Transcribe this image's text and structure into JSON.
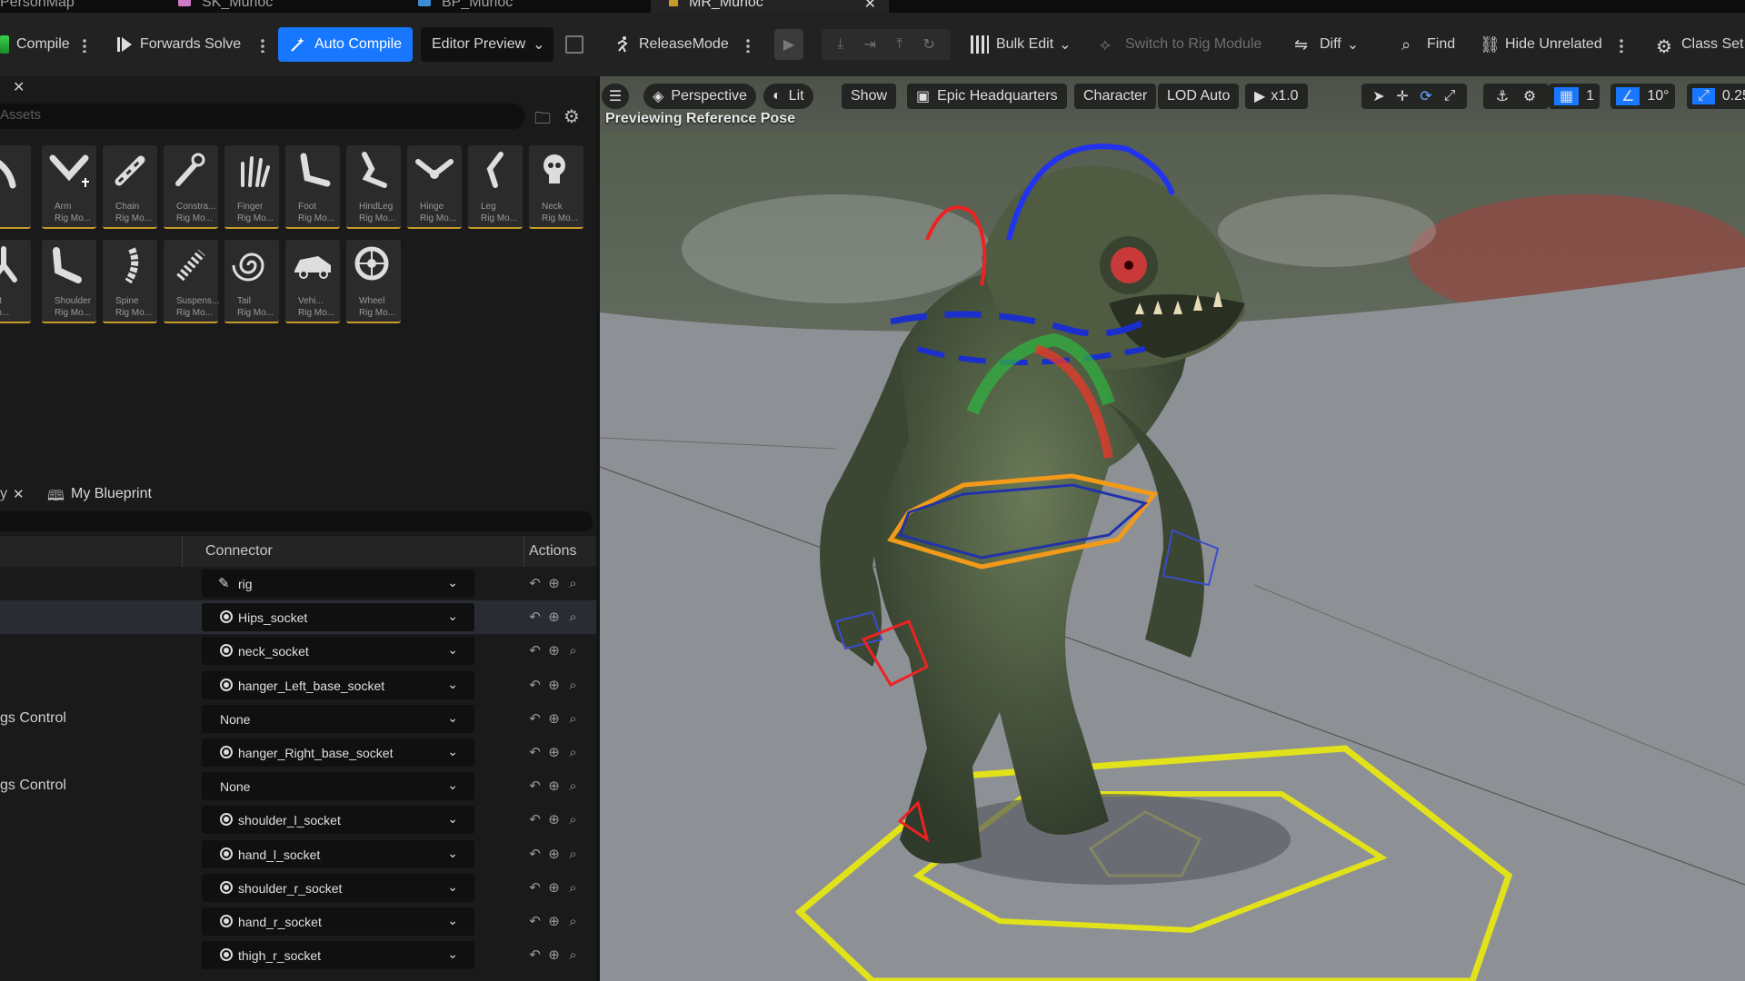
{
  "tabs": [
    {
      "label": "PersonMap",
      "active": false
    },
    {
      "label": "SK_Murloc",
      "active": false
    },
    {
      "label": "BP_Murloc",
      "active": false
    },
    {
      "label": "MR_Murloc",
      "active": true
    }
  ],
  "toolbar": {
    "compile": "Compile",
    "forwards_solve": "Forwards Solve",
    "auto_compile": "Auto Compile",
    "editor_preview": "Editor Preview",
    "release_mode": "ReleaseMode",
    "bulk_edit": "Bulk Edit",
    "switch_rig": "Switch to Rig Module",
    "diff": "Diff",
    "find": "Find",
    "hide_unrelated": "Hide Unrelated",
    "class_settings": "Class Set"
  },
  "assets": {
    "search_placeholder": "Assets",
    "row1": [
      {
        "l1": "",
        "l2": ""
      },
      {
        "l1": "Arm",
        "l2": "Rig Mo..."
      },
      {
        "l1": "Chain",
        "l2": "Rig Mo..."
      },
      {
        "l1": "Constra...",
        "l2": "Rig Mo..."
      },
      {
        "l1": "Finger",
        "l2": "Rig Mo..."
      },
      {
        "l1": "Foot",
        "l2": "Rig Mo..."
      },
      {
        "l1": "HindLeg",
        "l2": "Rig Mo..."
      },
      {
        "l1": "Hinge",
        "l2": "Rig Mo..."
      },
      {
        "l1": "Leg",
        "l2": "Rig Mo..."
      },
      {
        "l1": "Neck",
        "l2": "Rig Mo..."
      }
    ],
    "row2": [
      {
        "l1": "oot",
        "l2": "Mo..."
      },
      {
        "l1": "Shoulder",
        "l2": "Rig Mo..."
      },
      {
        "l1": "Spine",
        "l2": "Rig Mo..."
      },
      {
        "l1": "Suspens...",
        "l2": "Rig Mo..."
      },
      {
        "l1": "Tail",
        "l2": "Rig Mo..."
      },
      {
        "l1": "Vehi...",
        "l2": "Rig Mo..."
      },
      {
        "l1": "Wheel",
        "l2": "Rig Mo..."
      }
    ]
  },
  "blueprint": {
    "tab_label": "My Blueprint",
    "header_connector": "Connector",
    "header_actions": "Actions",
    "rows": [
      {
        "label": "",
        "value": "rig",
        "icon": "rig"
      },
      {
        "label": "",
        "value": "Hips_socket",
        "icon": "socket"
      },
      {
        "label": "",
        "value": "neck_socket",
        "icon": "socket"
      },
      {
        "label": "",
        "value": "hanger_Left_base_socket",
        "icon": "socket"
      },
      {
        "label": "gs Control",
        "value": "None",
        "icon": "none"
      },
      {
        "label": "",
        "value": "hanger_Right_base_socket",
        "icon": "socket"
      },
      {
        "label": "gs Control",
        "value": "None",
        "icon": "none"
      },
      {
        "label": "",
        "value": "shoulder_l_socket",
        "icon": "socket"
      },
      {
        "label": "",
        "value": "hand_l_socket",
        "icon": "socket"
      },
      {
        "label": "",
        "value": "shoulder_r_socket",
        "icon": "socket"
      },
      {
        "label": "",
        "value": "hand_r_socket",
        "icon": "socket"
      },
      {
        "label": "",
        "value": "thigh_r_socket",
        "icon": "socket"
      }
    ]
  },
  "viewport": {
    "perspective": "Perspective",
    "lit": "Lit",
    "show": "Show",
    "level": "Epic Headquarters",
    "character": "Character",
    "lod": "LOD Auto",
    "speed": "x1.0",
    "grid_value": "1",
    "angle_value": "10°",
    "scale_value": "0.25",
    "note": "Previewing Reference Pose"
  },
  "colors": {
    "accent": "#1778ff",
    "highlight": "#c79b2a"
  }
}
